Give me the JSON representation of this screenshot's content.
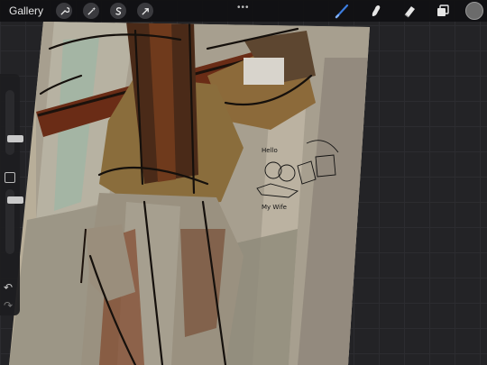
{
  "topbar": {
    "gallery_label": "Gallery",
    "left_tools": [
      "wrench-icon",
      "magic-wand-icon",
      "selection-s-icon",
      "transform-arrow-icon"
    ],
    "more_dots": "•••"
  },
  "right_tools": {
    "active_tool": "brush",
    "items": [
      "brush-icon",
      "smudge-icon",
      "eraser-icon",
      "layers-icon"
    ],
    "current_color": "#6b6b6b",
    "active_color": "#3c7de0"
  },
  "canvas": {
    "annotation_lines": [
      "Hello",
      "My Wife"
    ]
  },
  "sidebar": {
    "brush_size_level": 0.25,
    "opacity_level": 0.95,
    "undo_glyph": "↶",
    "redo_glyph": "↷"
  }
}
